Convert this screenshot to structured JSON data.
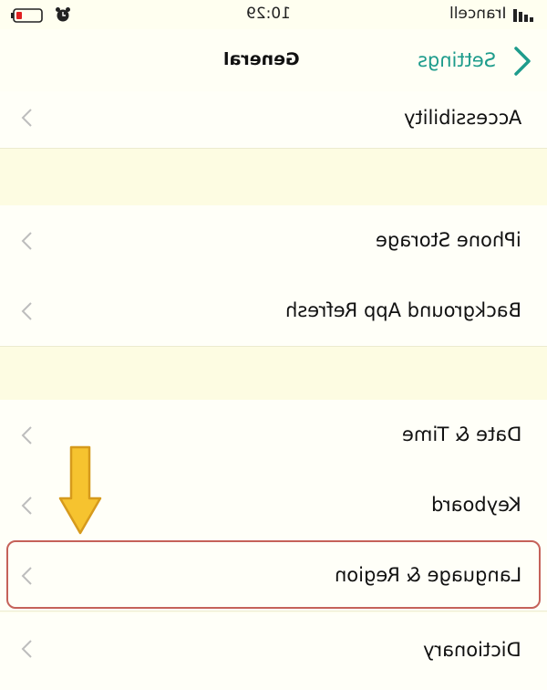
{
  "status_bar": {
    "time": "10:29",
    "carrier": "Irancell"
  },
  "nav": {
    "title": "General",
    "back_label": "Settings"
  },
  "rows": [
    {
      "label": "Accessibility"
    },
    {
      "label": "iPhone Storage"
    },
    {
      "label": "Background App Refresh"
    },
    {
      "label": "Date & Time"
    },
    {
      "label": "Keyboard"
    },
    {
      "label": "Language & Region"
    },
    {
      "label": "Dictionary"
    }
  ],
  "colors": {
    "accent": "#1e9c8c",
    "highlight_border": "#c5625a",
    "arrow_fill": "#f6c32f",
    "arrow_stroke": "#d69a1c"
  }
}
